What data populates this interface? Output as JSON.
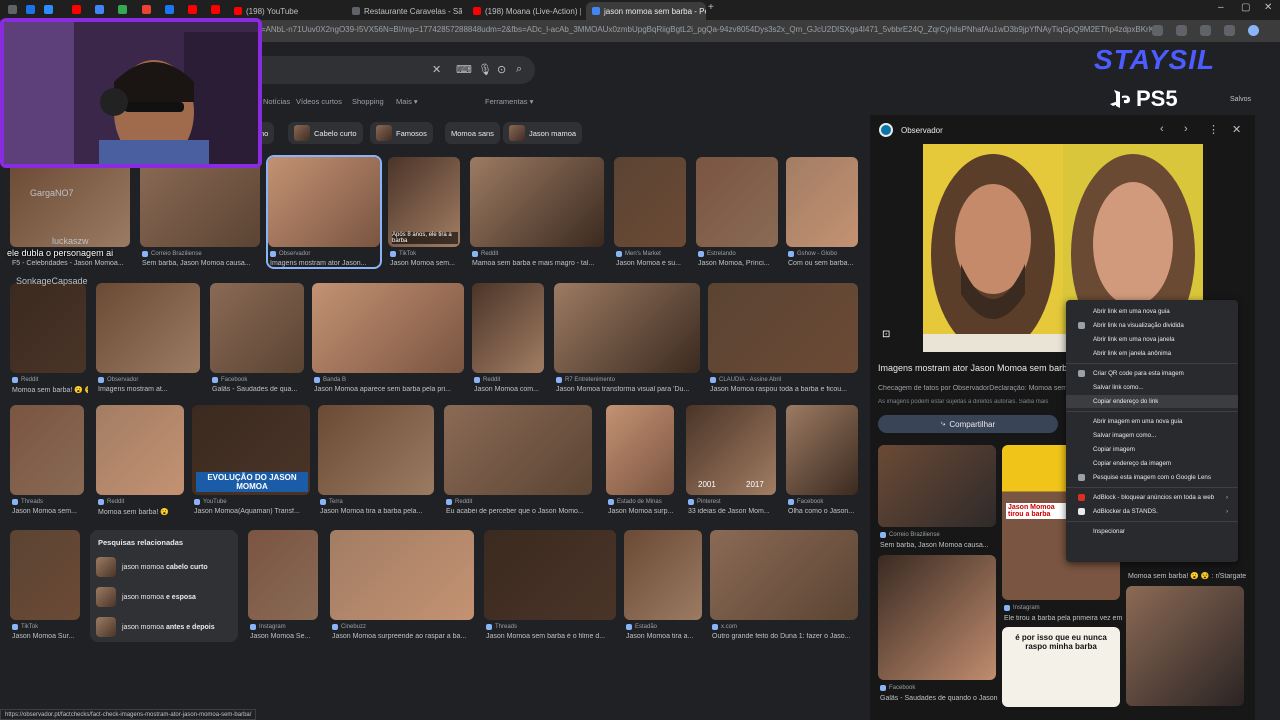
{
  "browser": {
    "tabs": [
      {
        "title": "(198) YouTube",
        "fav": "#ff0000"
      },
      {
        "title": "Restaurante Caravelas - São Br",
        "fav": "#5f6368"
      },
      {
        "title": "(198) Moana (Live-Action) | Tra",
        "fav": "#ff0000"
      },
      {
        "title": "jason momoa sem barba - Pesq",
        "fav": "#4285f4"
      }
    ],
    "url": "rsf=ANbL-n71Uuv0X2ngO39-I5VX56N=BI/mp=17742857288848udm=2&fbs=ADc_l-acAb_3MMOAUx0zmbUpgBqRiigBgtL2i_pgQa-94zv8054Dys3s2x_Qm_GJcU2DISXgs4I471_5vbbrE24Q_ZqrCyhilsPNhafAu1wD3b9jpYfNAyTiqGpQ9M2EThp4zdpxBKrKes47Iw6Lwb-6usTn-LOA8R8y427F8KA..."
  },
  "search": {
    "nav": [
      "Notícias",
      "Vídeos curtos",
      "Shopping",
      "Mais"
    ],
    "tools": "Ferramentas"
  },
  "chips": [
    "rismo",
    "Cabelo curto",
    "Famosos",
    "Momoa sans",
    "Jason mamoa"
  ],
  "results": [
    {
      "src": "",
      "cap": "F5 - Celebridades - Jason Momoa..."
    },
    {
      "src": "Correio Braziliense",
      "cap": "Sem barba, Jason Momoa causa..."
    },
    {
      "src": "Observador",
      "cap": "Imagens mostram ator Jason..."
    },
    {
      "src": "TikTok",
      "cap": "Jason Momoa sem..."
    },
    {
      "src": "Reddit",
      "cap": "Mamoa sem barba e mais magro - tal..."
    },
    {
      "src": "Men's Market",
      "cap": "Jason Momoa e su..."
    },
    {
      "src": "Estrelando",
      "cap": "Jason Momoa, Prínci..."
    },
    {
      "src": "Gshow - Globo",
      "cap": "Com ou sem barba..."
    },
    {
      "src": "Reddit",
      "cap": "Momoa sem barba! 😮 😵"
    },
    {
      "src": "Observador",
      "cap": "Imagens mostram at..."
    },
    {
      "src": "Facebook",
      "cap": "Galãs - Saudades de qua..."
    },
    {
      "src": "Banda B",
      "cap": "Jason Momoa aparece sem barba pela pri..."
    },
    {
      "src": "Reddit",
      "cap": "Jason Momoa com..."
    },
    {
      "src": "R7 Entretenimento",
      "cap": "Jason Momoa transforma visual para 'Du..."
    },
    {
      "src": "CLAUDIA - Assine Abril",
      "cap": "Jason Momoa raspou toda a barba e ficou..."
    },
    {
      "src": "Threads",
      "cap": "Jason Momoa sem..."
    },
    {
      "src": "Reddit",
      "cap": "Momoa sem barba! 😮"
    },
    {
      "src": "YouTube",
      "cap": "Jason Momoa(Aquaman) Transf..."
    },
    {
      "src": "Terra",
      "cap": "Jason Momoa tira a barba pela..."
    },
    {
      "src": "Reddit",
      "cap": "Eu acabei de perceber que o Jason Momo..."
    },
    {
      "src": "Estado de Minas",
      "cap": "Jason Momoa surp..."
    },
    {
      "src": "Pinterest",
      "cap": "33 ideias de Jason Mom..."
    },
    {
      "src": "Facebook",
      "cap": "Olha como o Jason..."
    },
    {
      "src": "TikTok",
      "cap": "Jason Momoa Sur..."
    },
    {
      "src": "Instagram",
      "cap": "Jason Momoa Se..."
    },
    {
      "src": "Cinebuzz",
      "cap": "Jason Momoa surpreende ao raspar a ba..."
    },
    {
      "src": "Threads",
      "cap": "Jason Momoa sem barba é o filme d..."
    },
    {
      "src": "Estadão",
      "cap": "Jason Momoa tira a..."
    },
    {
      "src": "x.com",
      "cap": "Outro grande feito do Duna 1: fazer o Jaso..."
    }
  ],
  "overlay_texts": {
    "dividing_years": [
      "2001",
      "2017"
    ],
    "evolution": "EVOLUÇÃO DO JASON MOMOA",
    "tiktok_overlay": "Após 8 anos, ele tira a barba"
  },
  "related": {
    "heading": "Pesquisas relacionadas",
    "items": [
      {
        "prefix": "jason momoa ",
        "bold": "cabelo curto"
      },
      {
        "prefix": "jason momoa ",
        "bold": "e esposa"
      },
      {
        "prefix": "jason momoa ",
        "bold": "antes e depois"
      }
    ]
  },
  "panel": {
    "source": "Observador",
    "title": "Imagens mostram ator Jason Momoa sem barb...",
    "desc": "Checagem de fatos por ObservadorDeclaração: Momoa sem",
    "note": "As imagens podem estar sujeitas a direitos autorais. Saiba mais",
    "share": "Compartilhar",
    "related_caps": [
      {
        "src": "Correio Braziliense",
        "cap": "Sem barba, Jason Momoa causa..."
      },
      {
        "src": "Instagram",
        "cap": "Ele tirou a barba pela primeira vez em..."
      },
      {
        "src": "Reddit",
        "cap": "Momoa sem barba! 😮 😵 : r/Stargate"
      },
      {
        "src": "Facebook",
        "cap": "Galãs - Saudades de quando o Jason..."
      }
    ],
    "meme1": "Jason Momoa tirou a barba",
    "meme2": "é por isso que eu nunca raspo minha barba"
  },
  "context_menu": [
    {
      "label": "Abrir link em uma nova guia",
      "hover": false,
      "sub": false
    },
    {
      "label": "Abrir link na visualização dividida",
      "hover": false,
      "sub": false
    },
    {
      "label": "Abrir link em uma nova janela",
      "hover": false,
      "sub": false
    },
    {
      "label": "Abrir link em janela anônima",
      "hover": false,
      "sub": false
    },
    {
      "label": "Criar QR code para esta imagem",
      "hover": false,
      "sub": false
    },
    {
      "label": "Salvar link como...",
      "hover": false,
      "sub": false
    },
    {
      "label": "Copiar endereço do link",
      "hover": true,
      "sub": false
    },
    {
      "label": "Abrir imagem em uma nova guia",
      "hover": false,
      "sub": false
    },
    {
      "label": "Salvar imagem como...",
      "hover": false,
      "sub": false
    },
    {
      "label": "Copiar imagem",
      "hover": false,
      "sub": false
    },
    {
      "label": "Copiar endereço da imagem",
      "hover": false,
      "sub": false
    },
    {
      "label": "Pesquise esta imagem com o Google Lens",
      "hover": false,
      "sub": false
    },
    {
      "label": "AdBlock - bloquear anúncios em toda a web",
      "hover": false,
      "sub": true
    },
    {
      "label": "AdBlocker da STANDS.",
      "hover": false,
      "sub": true
    },
    {
      "label": "Inspecionar",
      "hover": false,
      "sub": false
    }
  ],
  "stream": {
    "chat_text": "ele dubla o personagem ai",
    "viewer1": "GargaNO7",
    "viewer2": "luckaszw",
    "viewer3": "SonkageCapsade",
    "saves": "Salvos",
    "ps5": "PS5",
    "logo": "STAYSIL"
  },
  "statusbar": "https://observador.pt/factchecks/fact-check-imagens-mostram-ator-jason-momoa-sem-barba/"
}
